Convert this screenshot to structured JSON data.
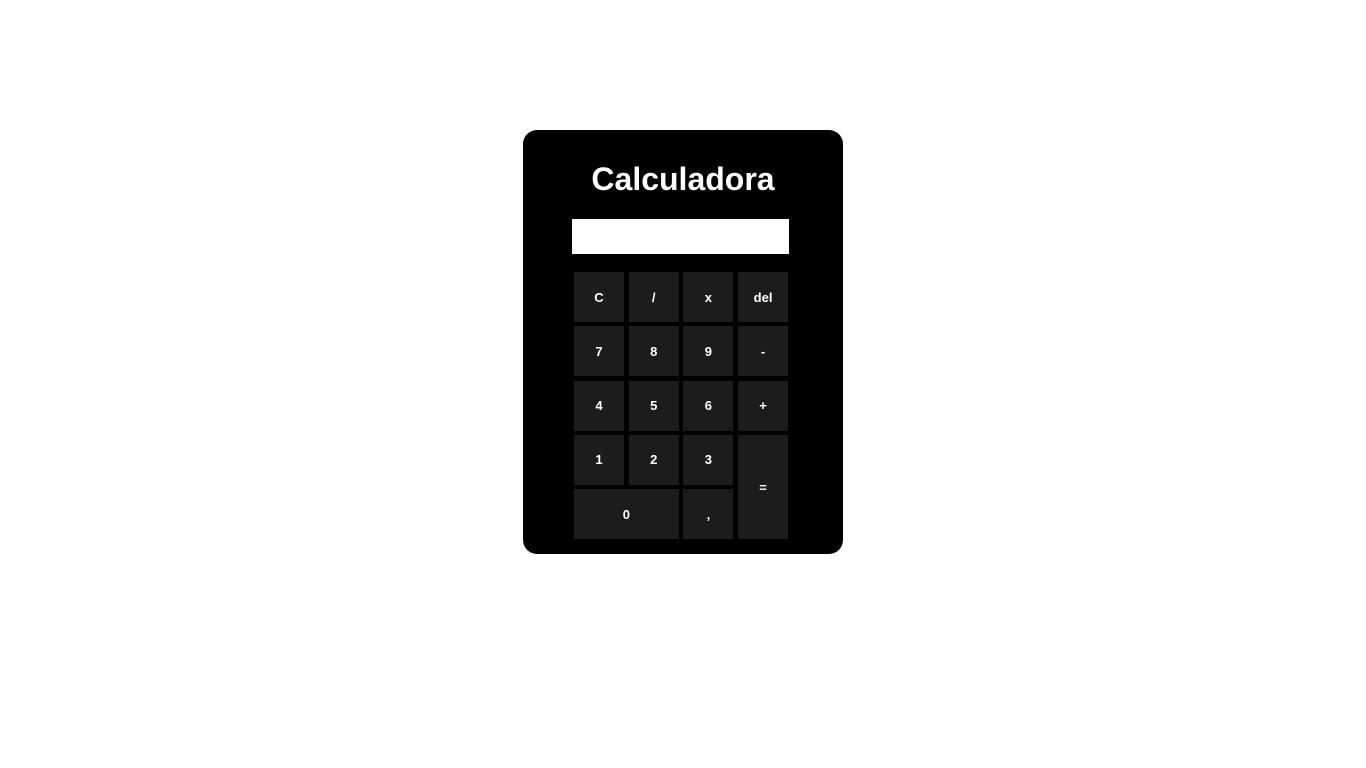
{
  "calculator": {
    "title": "Calculadora",
    "display": {
      "value": "",
      "placeholder": ""
    },
    "keys": {
      "clear": "C",
      "divide": "/",
      "multiply": "x",
      "delete": "del",
      "seven": "7",
      "eight": "8",
      "nine": "9",
      "minus": "-",
      "four": "4",
      "five": "5",
      "six": "6",
      "plus": "+",
      "one": "1",
      "two": "2",
      "three": "3",
      "equals": "=",
      "zero": "0",
      "comma": ","
    },
    "colors": {
      "page_background": "#ffffff",
      "panel_background": "#000000",
      "key_background": "#1c1c1c",
      "key_text": "#ffffff",
      "display_background": "#ffffff"
    }
  }
}
